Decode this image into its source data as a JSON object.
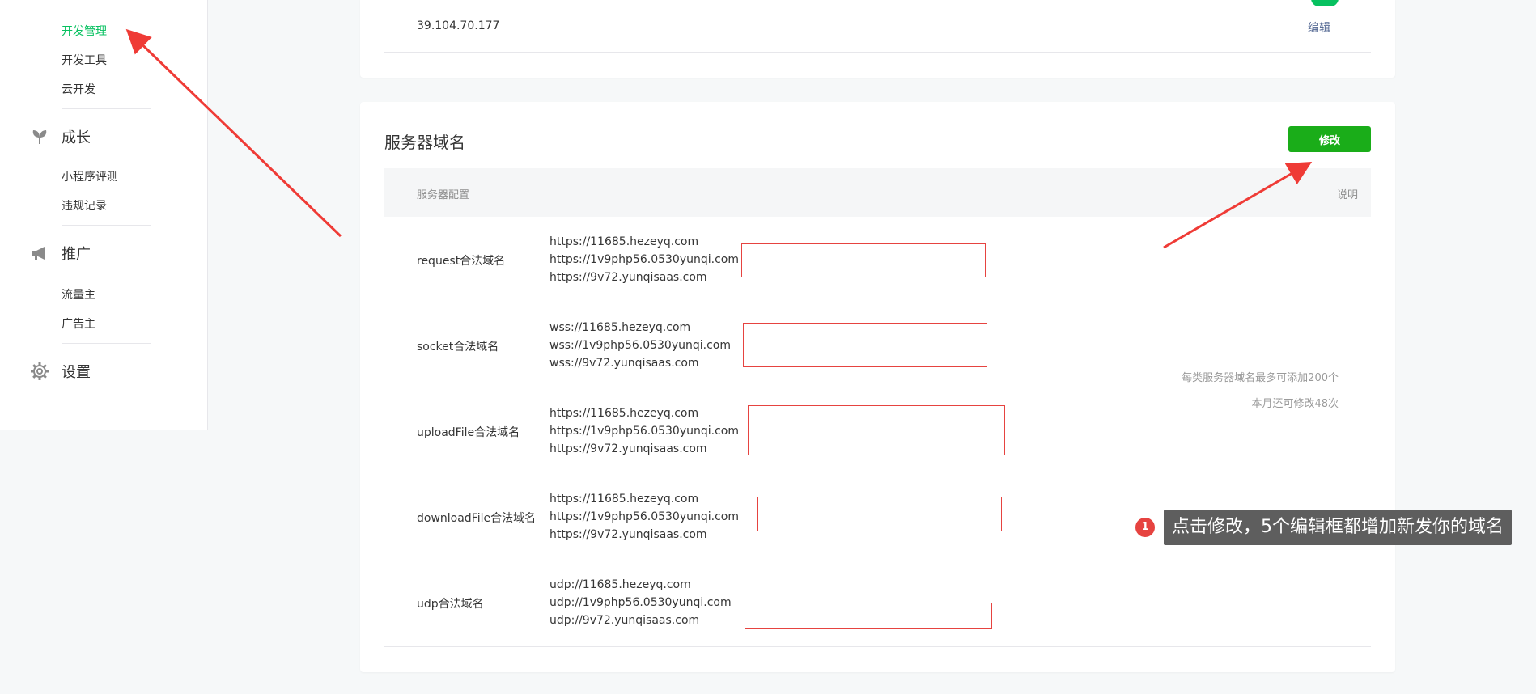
{
  "sidebar": {
    "dev_items": [
      "开发管理",
      "开发工具",
      "云开发"
    ],
    "growth": {
      "label": "成长",
      "items": [
        "小程序评测",
        "违规记录"
      ]
    },
    "promo": {
      "label": "推广",
      "items": [
        "流量主",
        "广告主"
      ]
    },
    "settings": {
      "label": "设置"
    }
  },
  "ip_card": {
    "ip": "39.104.70.177",
    "edit": "编辑"
  },
  "server": {
    "title": "服务器域名",
    "modify": "修改",
    "col_config": "服务器配置",
    "col_desc": "说明",
    "rows": [
      {
        "label": "request合法域名",
        "domains": [
          "https://11685.hezeyq.com",
          "https://1v9php56.0530yunqi.com",
          "https://9v72.yunqisaas.com"
        ]
      },
      {
        "label": "socket合法域名",
        "domains": [
          "wss://11685.hezeyq.com",
          "wss://1v9php56.0530yunqi.com",
          "wss://9v72.yunqisaas.com"
        ]
      },
      {
        "label": "uploadFile合法域名",
        "domains": [
          "https://11685.hezeyq.com",
          "https://1v9php56.0530yunqi.com",
          "https://9v72.yunqisaas.com"
        ]
      },
      {
        "label": "downloadFile合法域名",
        "domains": [
          "https://11685.hezeyq.com",
          "https://1v9php56.0530yunqi.com",
          "https://9v72.yunqisaas.com"
        ]
      },
      {
        "label": "udp合法域名",
        "domains": [
          "udp://11685.hezeyq.com",
          "udp://1v9php56.0530yunqi.com",
          "udp://9v72.yunqisaas.com"
        ]
      }
    ],
    "note_line1": "每类服务器域名最多可添加200个",
    "note_line2": "本月还可修改48次"
  },
  "annotation": {
    "badge": "1",
    "text": "点击修改，5个编辑框都增加新发你的域名"
  },
  "colors": {
    "accent_green": "#07c160",
    "button_green": "#1aad19",
    "highlight_red": "#e64340",
    "link_blue": "#576b95"
  },
  "icons": {
    "growth": "sprout-icon",
    "promo": "megaphone-icon",
    "settings": "gear-icon"
  }
}
